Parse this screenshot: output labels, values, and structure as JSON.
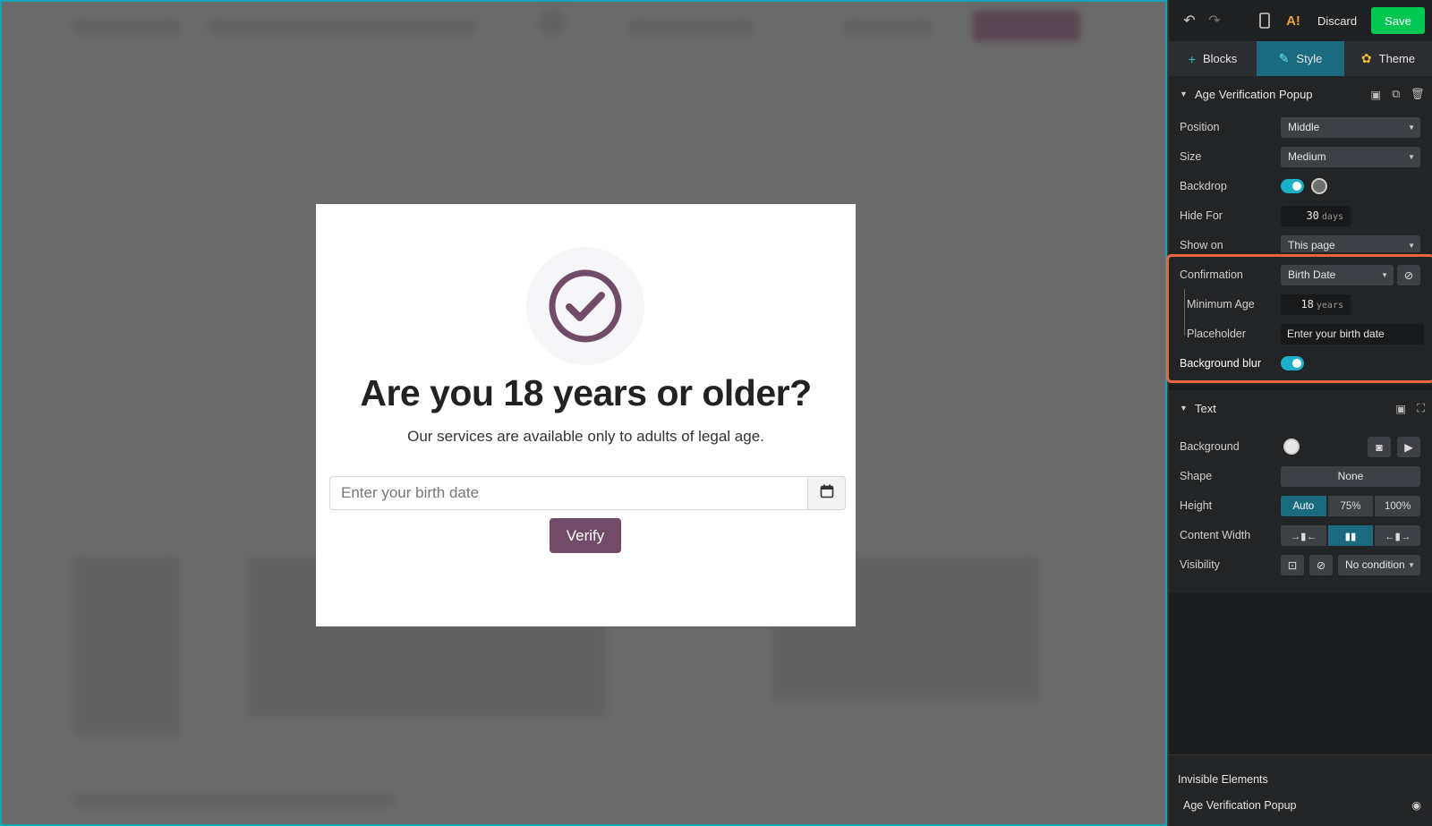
{
  "canvas": {
    "popup": {
      "title": "Are you 18 years or older?",
      "subtitle": "Our services are available only to adults of legal age.",
      "birth_placeholder": "Enter your birth date",
      "verify_label": "Verify",
      "check_icon": "check-circle-icon",
      "calendar_icon": "calendar-icon"
    }
  },
  "panel": {
    "topbar": {
      "discard_label": "Discard",
      "save_label": "Save"
    },
    "tabs": [
      {
        "label": "Blocks",
        "icon": "+"
      },
      {
        "label": "Style",
        "icon": "✎"
      },
      {
        "label": "Theme",
        "icon": "✿"
      }
    ],
    "popup_section": {
      "title": "Age Verification Popup",
      "position_label": "Position",
      "position_value": "Middle",
      "size_label": "Size",
      "size_value": "Medium",
      "backdrop_label": "Backdrop",
      "hide_for_label": "Hide For",
      "hide_for_value": "30",
      "hide_for_unit": "days",
      "show_on_label": "Show on",
      "show_on_value": "This page",
      "confirmation_label": "Confirmation",
      "confirmation_value": "Birth Date",
      "min_age_label": "Minimum Age",
      "min_age_value": "18",
      "min_age_unit": "years",
      "placeholder_label": "Placeholder",
      "placeholder_value": "Enter your birth date",
      "blur_label": "Background blur"
    },
    "text_section": {
      "title": "Text",
      "background_label": "Background",
      "shape_label": "Shape",
      "shape_value": "None",
      "height_label": "Height",
      "height_options": [
        "Auto",
        "75%",
        "100%"
      ],
      "content_width_label": "Content Width",
      "visibility_label": "Visibility",
      "visibility_value": "No condition"
    },
    "invisible": {
      "title": "Invisible Elements",
      "item": "Age Verification Popup"
    },
    "colors": {
      "accent": "#1a6b80",
      "save": "#00c853",
      "brand": "#714b67",
      "highlight": "#e8673a"
    }
  }
}
